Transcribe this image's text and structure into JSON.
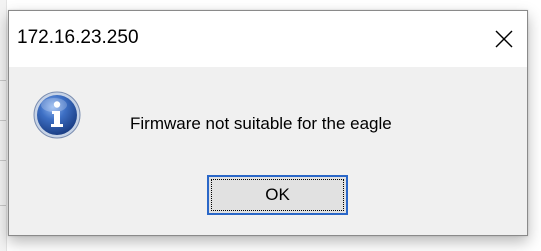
{
  "window": {
    "title": "172.16.23.250",
    "close_icon": "close-icon"
  },
  "message_box": {
    "icon": "info-icon",
    "text": "Firmware not suitable for the eagle",
    "ok_label": "OK"
  },
  "colors": {
    "titlebar_bg": "#ffffff",
    "client_bg": "#f0f0f0",
    "button_bg": "#e1e1e1",
    "button_focus_border": "#2a67c8",
    "icon_blue": "#2f5fae"
  }
}
